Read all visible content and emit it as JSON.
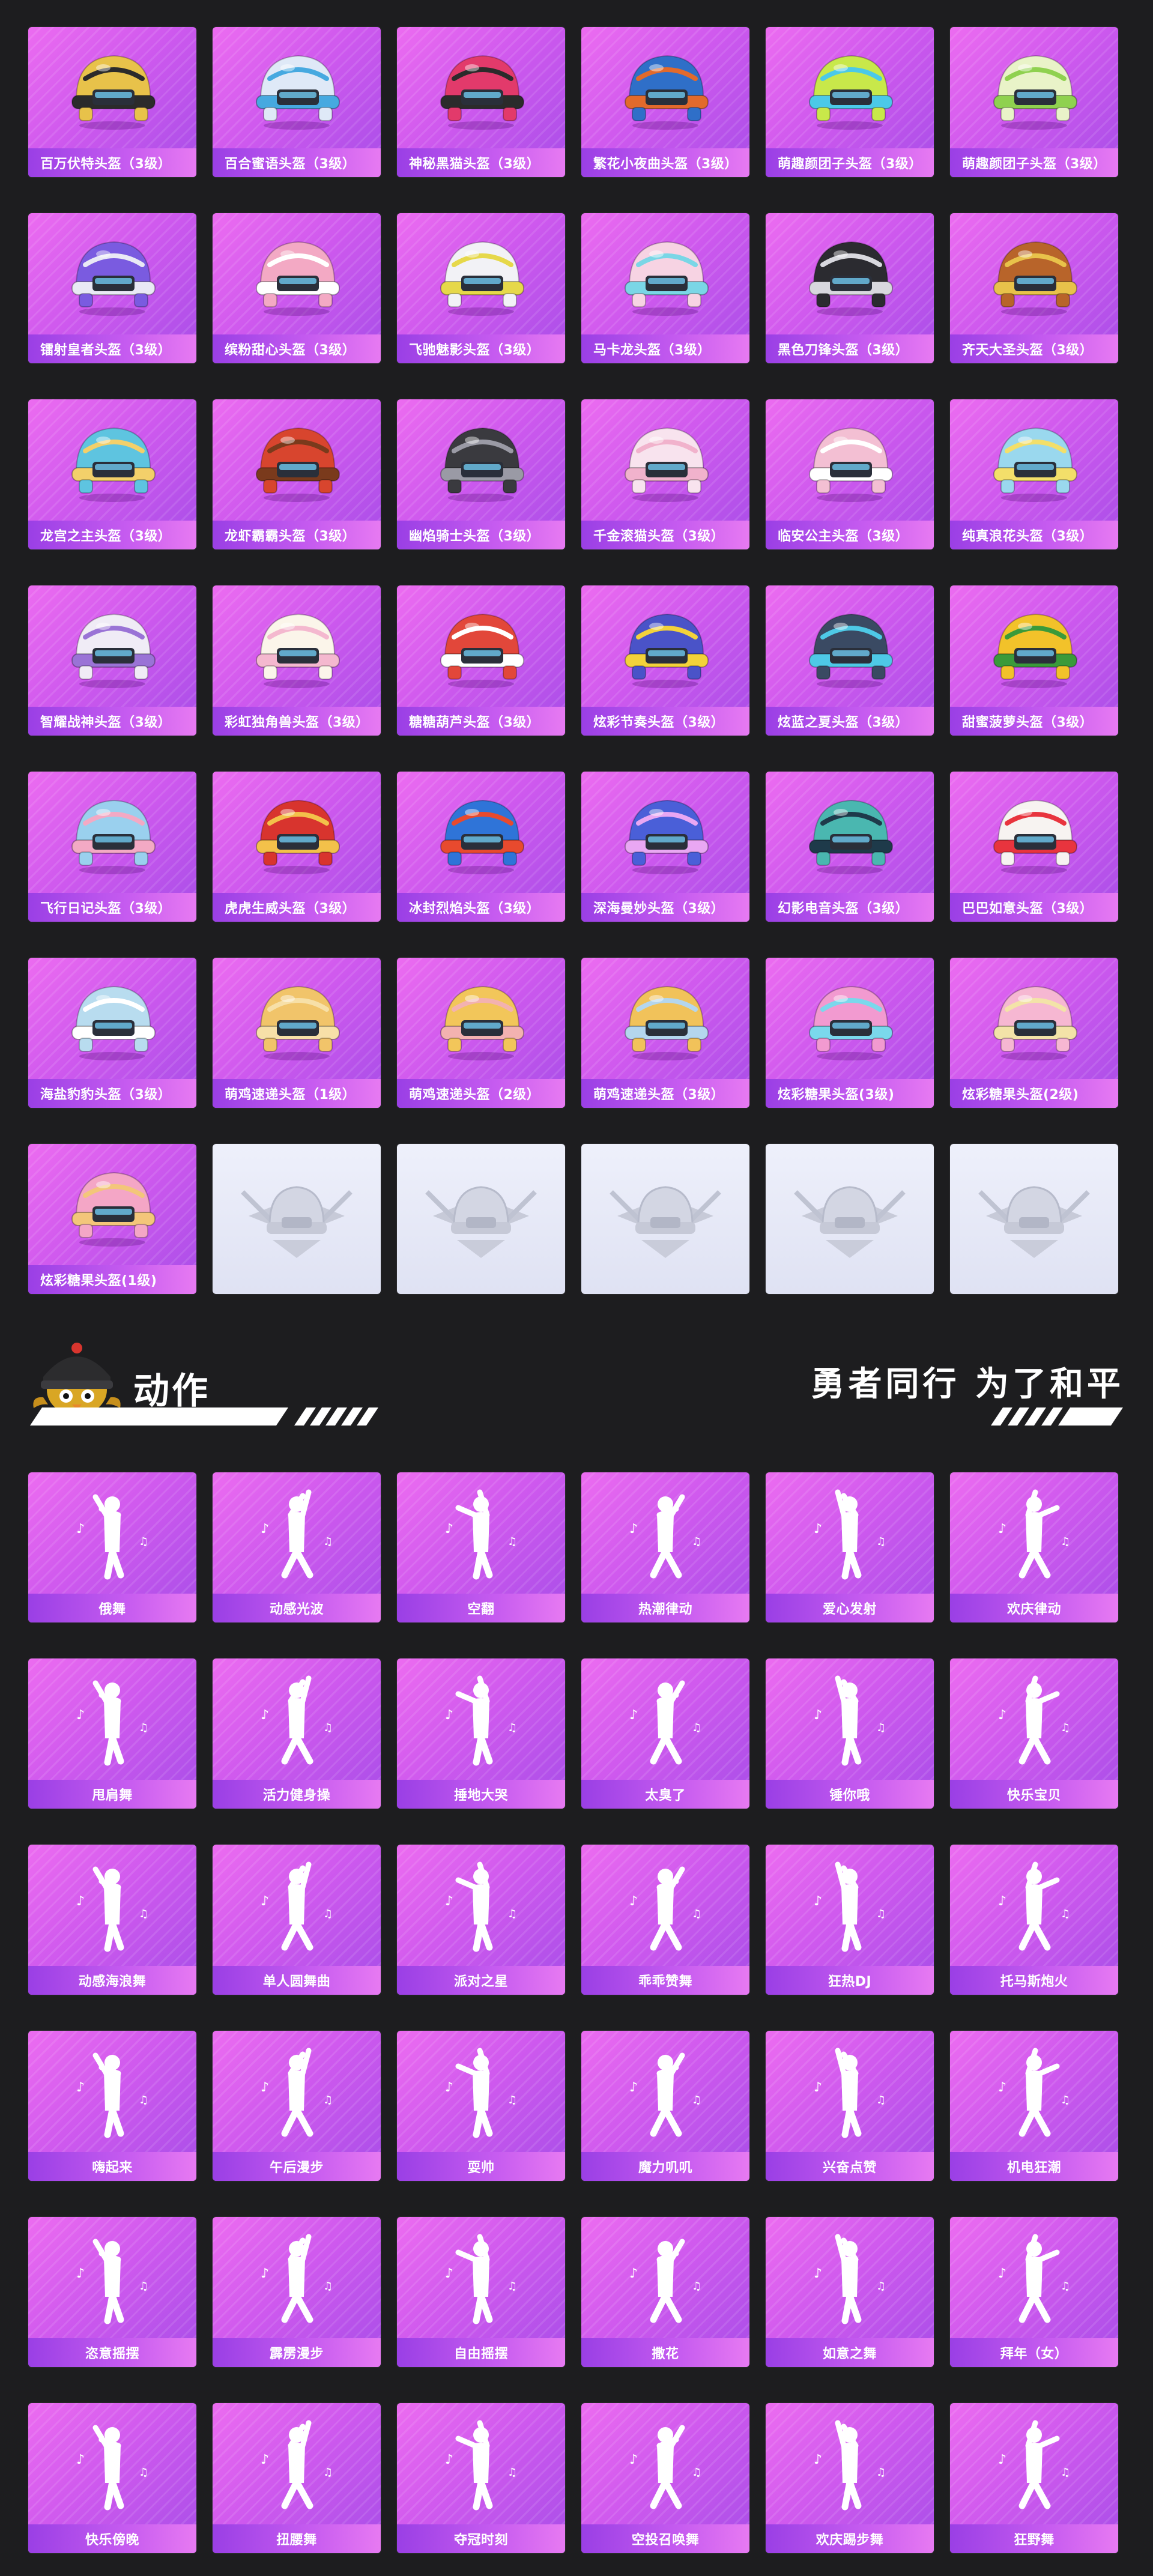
{
  "colors": {
    "background": "#1d1d1f",
    "card_gradient_start": "#ec6cf0",
    "card_gradient_end": "#a84ee8",
    "label_bar": "#9a3fe5",
    "placeholder": "#e4e7f6",
    "text": "#ffffff"
  },
  "helmets": [
    {
      "label": "百万伏特头盔（3级）",
      "main": "#e8c24a",
      "accent": "#2b2b2b",
      "icon": "helmet-icon"
    },
    {
      "label": "百合蜜语头盔（3级）",
      "main": "#dfe9f7",
      "accent": "#46a9e0",
      "icon": "helmet-icon"
    },
    {
      "label": "神秘黑猫头盔（3级）",
      "main": "#e23a6b",
      "accent": "#2b2b2b",
      "icon": "helmet-icon"
    },
    {
      "label": "繁花小夜曲头盔（3级）",
      "main": "#2f6fc8",
      "accent": "#e26a2c",
      "icon": "helmet-icon"
    },
    {
      "label": "萌趣颜团子头盔（3级）",
      "main": "#c8e84a",
      "accent": "#4bc9e8",
      "icon": "helmet-icon"
    },
    {
      "label": "萌趣颜团子头盔（3级）",
      "main": "#e9f3c8",
      "accent": "#8fd14f",
      "icon": "helmet-icon"
    },
    {
      "label": "镭射皇者头盔（3级）",
      "main": "#7a5be0",
      "accent": "#e9e9f5",
      "icon": "helmet-icon"
    },
    {
      "label": "缤粉甜心头盔（3级）",
      "main": "#f3a9c4",
      "accent": "#ffffff",
      "icon": "helmet-icon"
    },
    {
      "label": "飞驰魅影头盔（3级）",
      "main": "#f2f2f6",
      "accent": "#e6d84a",
      "icon": "helmet-icon"
    },
    {
      "label": "马卡龙头盔（3级）",
      "main": "#f7d3e3",
      "accent": "#7ad6e6",
      "icon": "helmet-icon"
    },
    {
      "label": "黑色刀锋头盔（3级）",
      "main": "#2b2b30",
      "accent": "#d8d8de",
      "icon": "helmet-icon"
    },
    {
      "label": "齐天大圣头盔（3级）",
      "main": "#b8642a",
      "accent": "#e8c24a",
      "icon": "helmet-icon"
    },
    {
      "label": "龙宫之主头盔（3级）",
      "main": "#5ec4e0",
      "accent": "#f3d06a",
      "icon": "helmet-icon"
    },
    {
      "label": "龙虾霸霸头盔（3级）",
      "main": "#d8452e",
      "accent": "#7a3a1c",
      "icon": "helmet-icon"
    },
    {
      "label": "幽焰骑士头盔（3级）",
      "main": "#3a3a3f",
      "accent": "#9a9aa5",
      "icon": "helmet-icon"
    },
    {
      "label": "千金滚猫头盔（3级）",
      "main": "#f8e3ee",
      "accent": "#f1b2cc",
      "icon": "helmet-icon"
    },
    {
      "label": "临安公主头盔（3级）",
      "main": "#f3bfd3",
      "accent": "#ffffff",
      "icon": "helmet-icon"
    },
    {
      "label": "纯真浪花头盔（3级）",
      "main": "#9ad8ee",
      "accent": "#f3df6a",
      "icon": "helmet-icon"
    },
    {
      "label": "智耀战神头盔（3级）",
      "main": "#f0ecf6",
      "accent": "#9a73d6",
      "icon": "helmet-icon"
    },
    {
      "label": "彩虹独角兽头盔（3级）",
      "main": "#fbf5ea",
      "accent": "#f4b8cf",
      "icon": "helmet-icon"
    },
    {
      "label": "糖糖葫芦头盔（3级）",
      "main": "#e2473a",
      "accent": "#ffffff",
      "icon": "helmet-icon"
    },
    {
      "label": "炫彩节奏头盔（3级）",
      "main": "#4a53c8",
      "accent": "#f3d23a",
      "icon": "helmet-icon"
    },
    {
      "label": "炫蓝之夏头盔（3级）",
      "main": "#3a4a63",
      "accent": "#4ec9e6",
      "icon": "helmet-icon"
    },
    {
      "label": "甜蜜菠萝头盔（3级）",
      "main": "#f2c22a",
      "accent": "#3a9a3a",
      "icon": "helmet-icon"
    },
    {
      "label": "飞行日记头盔（3级）",
      "main": "#9ad0ee",
      "accent": "#f3a9c4",
      "icon": "helmet-icon"
    },
    {
      "label": "虎虎生威头盔（3级）",
      "main": "#d8342e",
      "accent": "#f3c14a",
      "icon": "helmet-icon"
    },
    {
      "label": "冰封烈焰头盔（3级）",
      "main": "#2f74d8",
      "accent": "#e84a2e",
      "icon": "helmet-icon"
    },
    {
      "label": "深海曼妙头盔（3级）",
      "main": "#4a5fd8",
      "accent": "#e9a7f3",
      "icon": "helmet-icon"
    },
    {
      "label": "幻影电音头盔（3级）",
      "main": "#4ab7b0",
      "accent": "#1e3a4a",
      "icon": "helmet-icon"
    },
    {
      "label": "巴巴如意头盔（3级）",
      "main": "#f7f3f1",
      "accent": "#e8343e",
      "icon": "helmet-icon"
    },
    {
      "label": "海盐豹豹头盔（3级）",
      "main": "#b8dcef",
      "accent": "#ffffff",
      "icon": "helmet-icon"
    },
    {
      "label": "萌鸡速递头盔（1级）",
      "main": "#f1c46a",
      "accent": "#f7e0a8",
      "icon": "helmet-icon"
    },
    {
      "label": "萌鸡速递头盔（2级）",
      "main": "#f2c65a",
      "accent": "#f3b2b0",
      "icon": "helmet-icon"
    },
    {
      "label": "萌鸡速递头盔（3级）",
      "main": "#f1c25a",
      "accent": "#b4d6ee",
      "icon": "helmet-icon"
    },
    {
      "label": "炫彩糖果头盔(3级)",
      "main": "#f29ad0",
      "accent": "#7ad8ec",
      "icon": "helmet-icon"
    },
    {
      "label": "炫彩糖果头盔(2级)",
      "main": "#f6b7d2",
      "accent": "#f3e3a8",
      "icon": "helmet-icon"
    },
    {
      "label": "炫彩糖果头盔(1级)",
      "main": "#f4a6c6",
      "accent": "#f3c67a",
      "icon": "helmet-icon"
    }
  ],
  "placeholder_count": 5,
  "section": {
    "title": "动作",
    "slogan": "勇者同行 为了和平",
    "mascot_icon": "chick-helmet-mascot-icon"
  },
  "emotes": [
    {
      "label": "俄舞"
    },
    {
      "label": "动感光波"
    },
    {
      "label": "空翻"
    },
    {
      "label": "热潮律动"
    },
    {
      "label": "爱心发射"
    },
    {
      "label": "欢庆律动"
    },
    {
      "label": "甩肩舞"
    },
    {
      "label": "活力健身操"
    },
    {
      "label": "捶地大哭"
    },
    {
      "label": "太臭了"
    },
    {
      "label": "锤你哦"
    },
    {
      "label": "快乐宝贝"
    },
    {
      "label": "动感海浪舞"
    },
    {
      "label": "单人圆舞曲"
    },
    {
      "label": "派对之星"
    },
    {
      "label": "乖乖赞舞"
    },
    {
      "label": "狂热DJ"
    },
    {
      "label": "托马斯炮火"
    },
    {
      "label": "嗨起来"
    },
    {
      "label": "午后漫步"
    },
    {
      "label": "耍帅"
    },
    {
      "label": "魔力叽叽"
    },
    {
      "label": "兴奋点赞"
    },
    {
      "label": "机电狂潮"
    },
    {
      "label": "恣意摇摆"
    },
    {
      "label": "霹雳漫步"
    },
    {
      "label": "自由摇摆"
    },
    {
      "label": "撒花"
    },
    {
      "label": "如意之舞"
    },
    {
      "label": "拜年（女）"
    },
    {
      "label": "快乐傍晚"
    },
    {
      "label": "扭腰舞"
    },
    {
      "label": "夺冠时刻"
    },
    {
      "label": "空投召唤舞"
    },
    {
      "label": "欢庆踢步舞"
    },
    {
      "label": "狂野舞"
    }
  ]
}
